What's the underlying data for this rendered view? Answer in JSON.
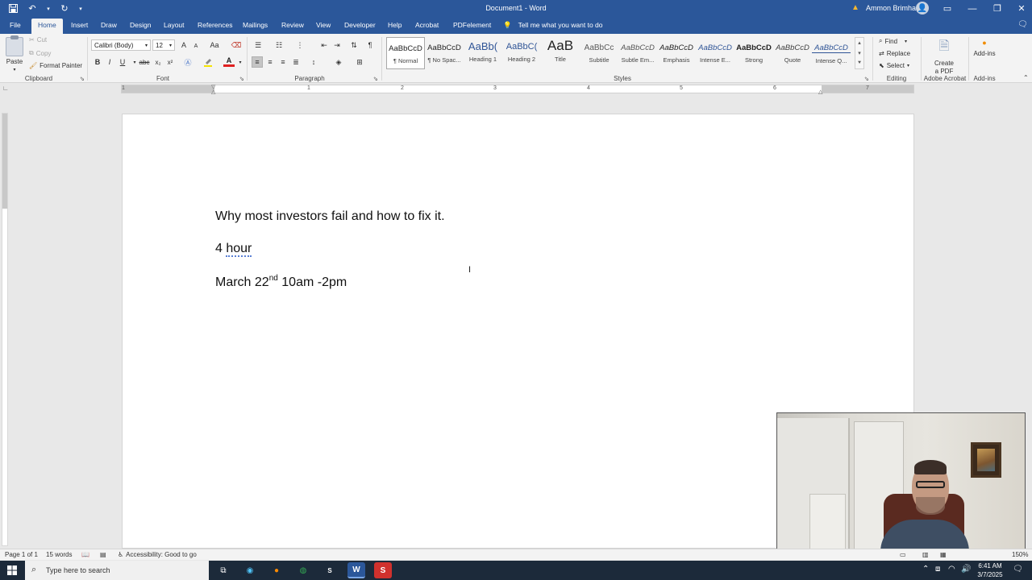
{
  "titlebar": {
    "doc_title": "Document1 - Word",
    "user_name": "Ammon Brimhall",
    "qat": {
      "save_icon": "save-icon",
      "undo_icon": "undo-icon",
      "redo_icon": "redo-icon",
      "customize_icon": "chevron-down-icon"
    },
    "window": {
      "minimize": "—",
      "restore": "❐",
      "close": "✕",
      "ribbon_display": "▭"
    }
  },
  "tabs": {
    "items": [
      "File",
      "Home",
      "Insert",
      "Draw",
      "Design",
      "Layout",
      "References",
      "Mailings",
      "Review",
      "View",
      "Developer",
      "Help",
      "Acrobat",
      "PDFelement"
    ],
    "active": "Home",
    "tell_me": "Tell me what you want to do"
  },
  "clipboard": {
    "paste": "Paste",
    "cut": "Cut",
    "copy": "Copy",
    "format_painter": "Format Painter",
    "label": "Clipboard"
  },
  "font": {
    "family": "Calibri (Body)",
    "size": "12",
    "label": "Font",
    "bold": "B",
    "italic": "I",
    "underline": "U",
    "strike": "abc",
    "subscript": "x₂",
    "superscript": "x²",
    "grow": "A",
    "shrink": "A",
    "change_case": "Aa",
    "font_color": "A"
  },
  "paragraph": {
    "label": "Paragraph"
  },
  "styles": {
    "label": "Styles",
    "items": [
      {
        "sample": "AaBbCcD",
        "name": "¶ Normal"
      },
      {
        "sample": "AaBbCcD",
        "name": "¶ No Spac..."
      },
      {
        "sample": "AaBb(",
        "name": "Heading 1"
      },
      {
        "sample": "AaBbC(",
        "name": "Heading 2"
      },
      {
        "sample": "AaB",
        "name": "Title"
      },
      {
        "sample": "AaBbCc",
        "name": "Subtitle"
      },
      {
        "sample": "AaBbCcD",
        "name": "Subtle Em..."
      },
      {
        "sample": "AaBbCcD",
        "name": "Emphasis"
      },
      {
        "sample": "AaBbCcD",
        "name": "Intense E..."
      },
      {
        "sample": "AaBbCcD",
        "name": "Strong"
      },
      {
        "sample": "AaBbCcD",
        "name": "Quote"
      },
      {
        "sample": "AaBbCcD",
        "name": "Intense Q..."
      }
    ]
  },
  "editing": {
    "find": "Find",
    "replace": "Replace",
    "select": "Select",
    "label": "Editing"
  },
  "acrobat": {
    "create_pdf_line1": "Create",
    "create_pdf_line2": "a PDF",
    "label": "Adobe Acrobat"
  },
  "addins": {
    "button": "Add-ins",
    "label": "Add-ins"
  },
  "ruler": {
    "numbers": [
      "1",
      "1",
      "2",
      "3",
      "4",
      "5",
      "6",
      "7"
    ]
  },
  "document": {
    "line1": "Why most investors fail and how to fix it.",
    "line2_num": "4",
    "line2_word": "hour",
    "line3_pre": "March 22",
    "line3_sup": "nd",
    "line3_post": " 10am -2pm"
  },
  "statusbar": {
    "page": "Page 1 of 1",
    "words": "15 words",
    "accessibility": "Accessibility: Good to go",
    "zoom": "150%"
  },
  "taskbar": {
    "search_placeholder": "Type here to search",
    "time": "6:41 AM",
    "date": "3/7/2025"
  },
  "colors": {
    "word_blue": "#2b579a",
    "ribbon_bg": "#f3f3f3",
    "font_color_red": "#e02020",
    "highlight_yellow": "#f5e400"
  }
}
